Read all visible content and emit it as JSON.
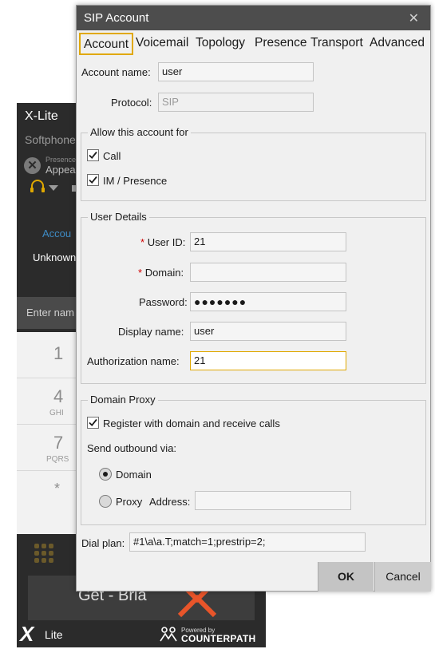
{
  "xlite": {
    "title": "X-Lite",
    "subtitle": "Softphone",
    "presence_small": "Presence",
    "presence_value": "Appea",
    "account_link": "Accou",
    "status": "Unknown",
    "enter_placeholder": "Enter nam",
    "dialpad": [
      {
        "num": "1",
        "letters": ""
      },
      {
        "num": "4",
        "letters": "GHI"
      },
      {
        "num": "7",
        "letters": "PQRS"
      },
      {
        "num": "*",
        "letters": ""
      }
    ],
    "banner_text": "Get - Bria",
    "logo_x": "X",
    "logo_lite": "Lite",
    "powered_by": "Powered by",
    "brand": "COUNTERPATH"
  },
  "dialog": {
    "title": "SIP Account",
    "close_glyph": "✕",
    "tabs": [
      "Account",
      "Voicemail",
      "Topology",
      "Presence",
      "Transport",
      "Advanced"
    ],
    "account_name_label": "Account name:",
    "account_name": "user",
    "protocol_label": "Protocol:",
    "protocol": "SIP",
    "allow_group": "Allow this account for",
    "call_label": "Call",
    "call_checked": true,
    "im_label": "IM / Presence",
    "im_checked": true,
    "user_group": "User Details",
    "required_mark": "*",
    "user_id_label": "User ID:",
    "user_id": "21",
    "domain_label": "Domain:",
    "domain": "",
    "password_label": "Password:",
    "password": "●●●●●●●",
    "display_name_label": "Display name:",
    "display_name": "user",
    "auth_name_label": "Authorization name:",
    "auth_name": "21",
    "proxy_group": "Domain Proxy",
    "register_label": "Register with domain and receive calls",
    "register_checked": true,
    "send_outbound_label": "Send outbound via:",
    "domain_radio_label": "Domain",
    "proxy_radio_label": "Proxy",
    "address_label": "Address:",
    "address": "",
    "selected_outbound": "Domain",
    "dial_plan_label": "Dial plan:",
    "dial_plan": "#1\\a\\a.T;match=1;prestrip=2;",
    "ok_label": "OK",
    "cancel_label": "Cancel"
  },
  "colors": {
    "titlebar": "#4d4d4d",
    "focus_accent": "#e0a800",
    "required": "#d00000",
    "xlite_bg": "#2b2b2b",
    "link": "#3e8bc4"
  }
}
